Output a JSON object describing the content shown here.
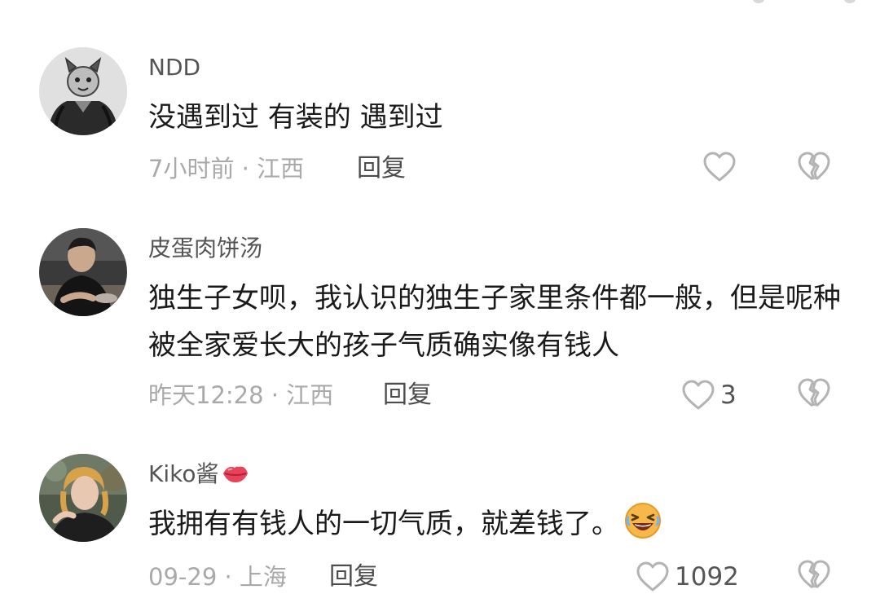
{
  "comments": [
    {
      "username": "NDD",
      "text": "没遇到过 有装的 遇到过",
      "meta": "7小时前 · 江西",
      "reply_label": "回复",
      "like_count": "",
      "avatar_icon": "avatar-cat-figure"
    },
    {
      "username": "皮蛋肉饼汤",
      "text": "独生子女呗，我认识的独生子家里条件都一般，但是呢种被全家爱长大的孩子气质确实像有钱人",
      "meta": "昨天12:28 · 江西",
      "reply_label": "回复",
      "like_count": "3",
      "avatar_icon": "avatar-man-photo"
    },
    {
      "username": "Kiko酱",
      "text": "我拥有有钱人的一切气质，就差钱了。",
      "meta": "09-29 · 上海",
      "reply_label": "回复",
      "like_count": "1092",
      "avatar_icon": "avatar-woman-photo"
    }
  ],
  "icons": {
    "like": "heart-outline-icon",
    "dislike": "broken-heart-icon",
    "laugh_emoji": "laughing-face-emoji",
    "kiss_emoji": "kiss-lips-emoji"
  },
  "colors": {
    "text": "#1a1a1a",
    "meta": "#a9a9a9",
    "icon_stroke": "#b3b3b3"
  }
}
